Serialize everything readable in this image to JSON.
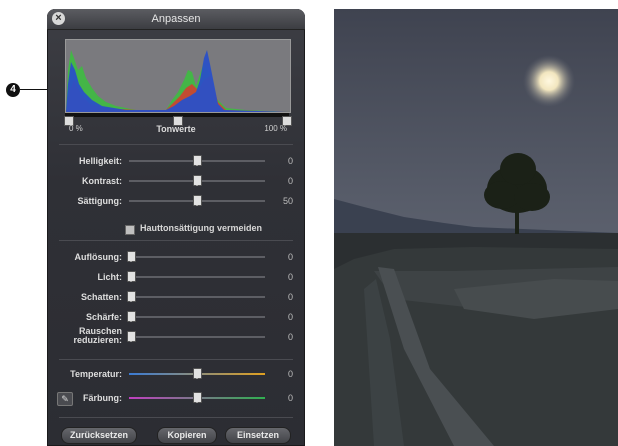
{
  "callout": {
    "number": "4"
  },
  "panel": {
    "title": "Anpassen",
    "levels": {
      "left_label": "0 %",
      "title": "Tonwerte",
      "right_label": "100 %"
    },
    "sliders_group1": [
      {
        "label": "Helligkeit:",
        "value": "0",
        "position": 0.5
      },
      {
        "label": "Kontrast:",
        "value": "0",
        "position": 0.5
      },
      {
        "label": "Sättigung:",
        "value": "50",
        "position": 0.5
      }
    ],
    "checkbox_label": "Hauttonsättigung vermeiden",
    "sliders_group2": [
      {
        "label": "Auflösung:",
        "value": "0",
        "position": 0.0
      },
      {
        "label": "Licht:",
        "value": "0",
        "position": 0.0
      },
      {
        "label": "Schatten:",
        "value": "0",
        "position": 0.0
      },
      {
        "label": "Schärfe:",
        "value": "0",
        "position": 0.0
      },
      {
        "label_line1": "Rauschen",
        "label_line2": "reduzieren:",
        "value": "0",
        "position": 0.0
      }
    ],
    "sliders_group3": [
      {
        "label": "Temperatur:",
        "value": "0",
        "position": 0.5
      },
      {
        "label": "Färbung:",
        "value": "0",
        "position": 0.5
      }
    ],
    "buttons": {
      "reset": "Zurücksetzen",
      "copy": "Kopieren",
      "paste": "Einsetzen"
    }
  },
  "colors": {
    "accent_temp_start": "#3a7bd5",
    "accent_temp_end": "#e0a020",
    "accent_tint_start": "#c040c0",
    "accent_tint_end": "#30b050"
  }
}
